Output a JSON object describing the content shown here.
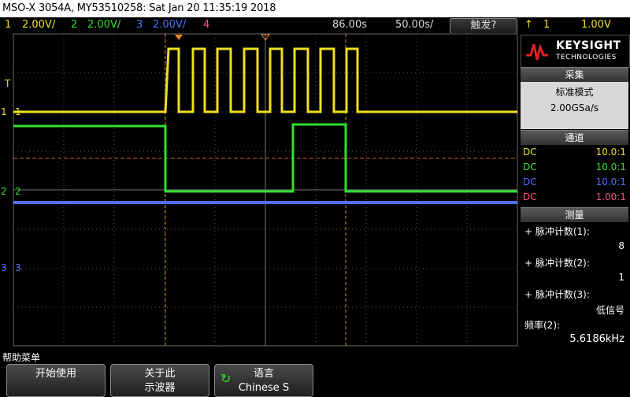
{
  "title": "MSO-X 3054A, MY53510258: Sat Jan 20 11:35:19 2018",
  "channels": [
    {
      "num": "1",
      "scale": "2.00V/",
      "color": "#f0e020"
    },
    {
      "num": "2",
      "scale": "2.00V/",
      "color": "#30e030"
    },
    {
      "num": "3",
      "scale": "2.00V/",
      "color": "#5070ff"
    },
    {
      "num": "4",
      "color": "#ff5080"
    }
  ],
  "timebase": {
    "delay": "86.00s",
    "scale": "50.00s/"
  },
  "trigger": {
    "button": "触发?",
    "source": "1",
    "level": "1.00V"
  },
  "brand": {
    "name": "KEYSIGHT",
    "sub": "TECHNOLOGIES"
  },
  "acquire": {
    "header": "采集",
    "mode": "标准模式",
    "rate": "2.00GSa/s"
  },
  "channel_panel": {
    "header": "通道",
    "rows": [
      {
        "coupling": "DC",
        "probe": "10.0:1",
        "color": "#f0e020"
      },
      {
        "coupling": "DC",
        "probe": "10.0:1",
        "color": "#30e030"
      },
      {
        "coupling": "DC",
        "probe": "10.0:1",
        "color": "#5070ff"
      },
      {
        "coupling": "DC",
        "probe": "1.00:1",
        "color": "#ff5080"
      }
    ]
  },
  "measure": {
    "header": "测量",
    "items": [
      {
        "label": "+ 脉冲计数(1):",
        "value": "8"
      },
      {
        "label": "+ 脉冲计数(2):",
        "value": "1"
      },
      {
        "label": "+ 脉冲计数(3):",
        "value": "低信号"
      },
      {
        "label": "频率(2):",
        "value": "5.6186kHz"
      }
    ]
  },
  "markers": {
    "trigger_marker": "T",
    "ch1": "1",
    "ch2": "2",
    "ch3": "3"
  },
  "help_menu": {
    "label": "帮助菜单"
  },
  "softkeys": [
    {
      "line1": "开始使用",
      "line2": ""
    },
    {
      "line1": "关于此",
      "line2": "示波器"
    },
    {
      "line1": "语言",
      "line2": "Chinese S"
    }
  ]
}
